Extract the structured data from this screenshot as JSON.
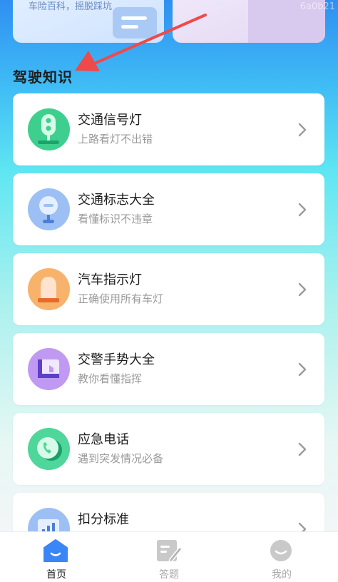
{
  "banner": {
    "left_teaser": "车险百科，摇脱踩坑",
    "watermark": "6a0b21"
  },
  "section": {
    "title": "驾驶知识"
  },
  "items": [
    {
      "title": "交通信号灯",
      "subtitle": "上路看灯不出错",
      "icon": "traffic-light-icon",
      "color": "#3ecf8e"
    },
    {
      "title": "交通标志大全",
      "subtitle": "看懂标识不违章",
      "icon": "road-sign-icon",
      "color": "#8fb7f2"
    },
    {
      "title": "汽车指示灯",
      "subtitle": "正确使用所有车灯",
      "icon": "car-indicator-icon",
      "color": "#f7b36b"
    },
    {
      "title": "交警手势大全",
      "subtitle": "教你看懂指挥",
      "icon": "hand-gesture-icon",
      "color": "#b58af0"
    },
    {
      "title": "应急电话",
      "subtitle": "遇到突发情况必备",
      "icon": "phone-icon",
      "color": "#3ecf8e"
    },
    {
      "title": "扣分标准",
      "subtitle": "",
      "icon": "score-chart-icon",
      "color": "#8fb7f2"
    }
  ],
  "tabbar": {
    "tabs": [
      {
        "label": "首页",
        "icon": "home-icon",
        "active": true
      },
      {
        "label": "答题",
        "icon": "quiz-icon",
        "active": false
      },
      {
        "label": "我的",
        "icon": "profile-icon",
        "active": false
      }
    ],
    "active_color": "#3b86f6",
    "inactive_color": "#c9c9c9"
  }
}
